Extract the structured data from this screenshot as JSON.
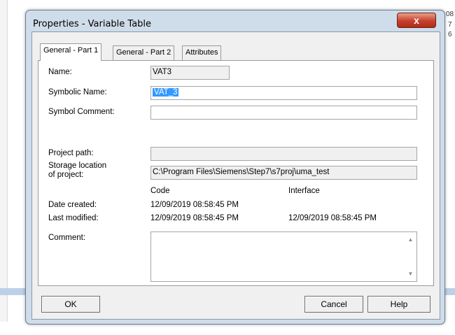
{
  "background": {
    "numbers": [
      "08",
      "7",
      "6"
    ]
  },
  "dialog": {
    "title": "Properties - Variable Table",
    "close_label": "x"
  },
  "tabs": [
    {
      "label": "General - Part 1"
    },
    {
      "label": "General - Part 2"
    },
    {
      "label": "Attributes"
    }
  ],
  "form": {
    "name_label": "Name:",
    "name_value": "VAT3",
    "symbolic_name_label": "Symbolic Name:",
    "symbolic_name_value": "VAT_3",
    "symbol_comment_label": "Symbol Comment:",
    "symbol_comment_value": "",
    "project_path_label": "Project path:",
    "project_path_value": "",
    "storage_label_line1": "Storage location",
    "storage_label_line2": "of project:",
    "storage_value": "C:\\Program Files\\Siemens\\Step7\\s7proj\\uma_test",
    "code_header": "Code",
    "interface_header": "Interface",
    "date_created_label": "Date created:",
    "date_created_code": "12/09/2019 08:58:45 PM",
    "last_modified_label": "Last modified:",
    "last_modified_code": "12/09/2019 08:58:45 PM",
    "last_modified_interface": "12/09/2019 08:58:45 PM",
    "comment_label": "Comment:",
    "comment_value": ""
  },
  "buttons": {
    "ok": "OK",
    "cancel": "Cancel",
    "help": "Help"
  },
  "colors": {
    "selection": "#3399ff",
    "window_frame": "#cfdcea",
    "close_button": "#c6402b"
  }
}
